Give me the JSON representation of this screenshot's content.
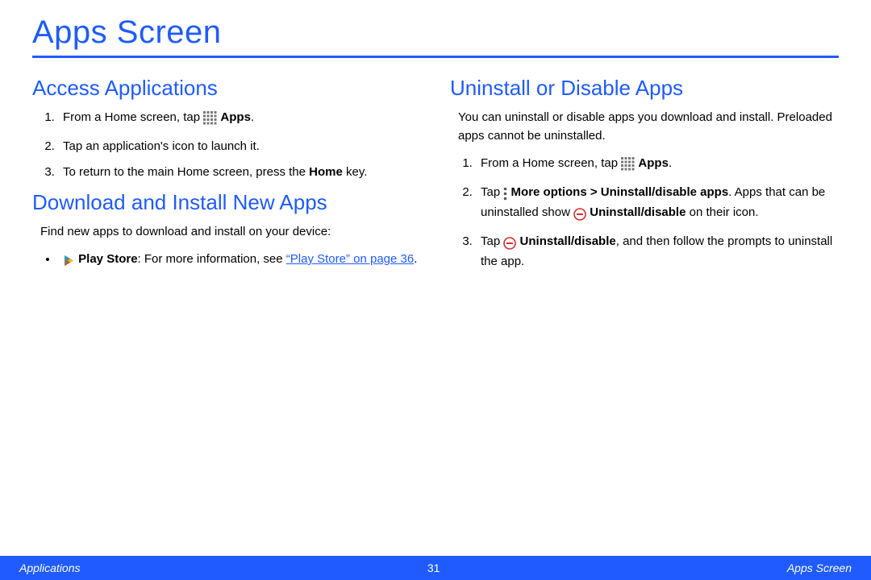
{
  "page_title": "Apps Screen",
  "left": {
    "access": {
      "title": "Access Applications",
      "step1_pre": "From a Home screen, tap ",
      "step1_bold": "Apps",
      "step1_post": ".",
      "step2": "Tap an application's icon to launch it.",
      "step3_pre": "To return to the main Home screen, press the ",
      "step3_bold": "Home",
      "step3_post": " key."
    },
    "download": {
      "title": "Download and Install New Apps",
      "intro": "Find new apps to download and install on your device:",
      "bullet_bold": "Play Store",
      "bullet_text": ": For more information, see ",
      "bullet_link": "“Play Store” on page 36",
      "bullet_post": "."
    }
  },
  "right": {
    "uninstall": {
      "title": "Uninstall or Disable Apps",
      "intro": "You can uninstall or disable apps you download and install. Preloaded apps cannot be uninstalled.",
      "step1_pre": "From a Home screen, tap ",
      "step1_bold": "Apps",
      "step1_post": ".",
      "step2_pre": "Tap ",
      "step2_bold1": "More options > Uninstall/disable apps",
      "step2_mid": ". Apps that can be uninstalled show ",
      "step2_bold2": "Uninstall/disable",
      "step2_post": " on their icon.",
      "step3_pre": "Tap ",
      "step3_bold": "Uninstall/disable",
      "step3_post": ", and then follow the prompts to uninstall the app."
    }
  },
  "footer": {
    "left": "Applications",
    "center": "31",
    "right": "Apps Screen"
  }
}
